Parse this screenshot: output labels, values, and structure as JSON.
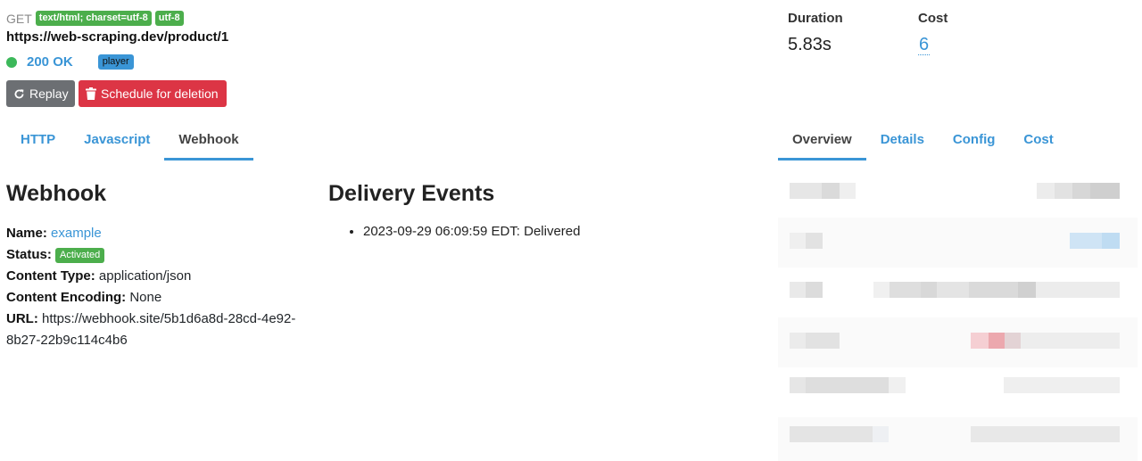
{
  "request": {
    "method": "GET",
    "content_type_badge": "text/html; charset=utf-8",
    "encoding_badge": "utf-8",
    "url": "https://web-scraping.dev/product/1",
    "status": "200 OK",
    "player_badge": "player",
    "status_color": "#3cb85a"
  },
  "actions": {
    "replay_label": "Replay",
    "delete_label": "Schedule for deletion"
  },
  "metrics": {
    "duration_label": "Duration",
    "duration_value": "5.83s",
    "cost_label": "Cost",
    "cost_value": "6"
  },
  "left_tabs": [
    {
      "label": "HTTP"
    },
    {
      "label": "Javascript"
    },
    {
      "label": "Webhook"
    }
  ],
  "right_tabs": [
    {
      "label": "Overview"
    },
    {
      "label": "Details"
    },
    {
      "label": "Config"
    },
    {
      "label": "Cost"
    }
  ],
  "webhook": {
    "title": "Webhook",
    "name_label": "Name:",
    "name_value": "example",
    "status_label": "Status:",
    "status_value": "Activated",
    "content_type_label": "Content Type:",
    "content_type_value": "application/json",
    "encoding_label": "Content Encoding:",
    "encoding_value": "None",
    "url_label": "URL:",
    "url_value": "https://webhook.site/5b1d6a8d-28cd-4e92-8b27-22b9c114c4b6"
  },
  "delivery": {
    "title": "Delivery Events",
    "events": [
      "2023-09-29 06:09:59 EDT: Delivered"
    ]
  },
  "colors": {
    "accent": "#3a95d6",
    "success": "#4cae4c",
    "danger": "#dc3545",
    "secondary": "#6c6f73"
  }
}
